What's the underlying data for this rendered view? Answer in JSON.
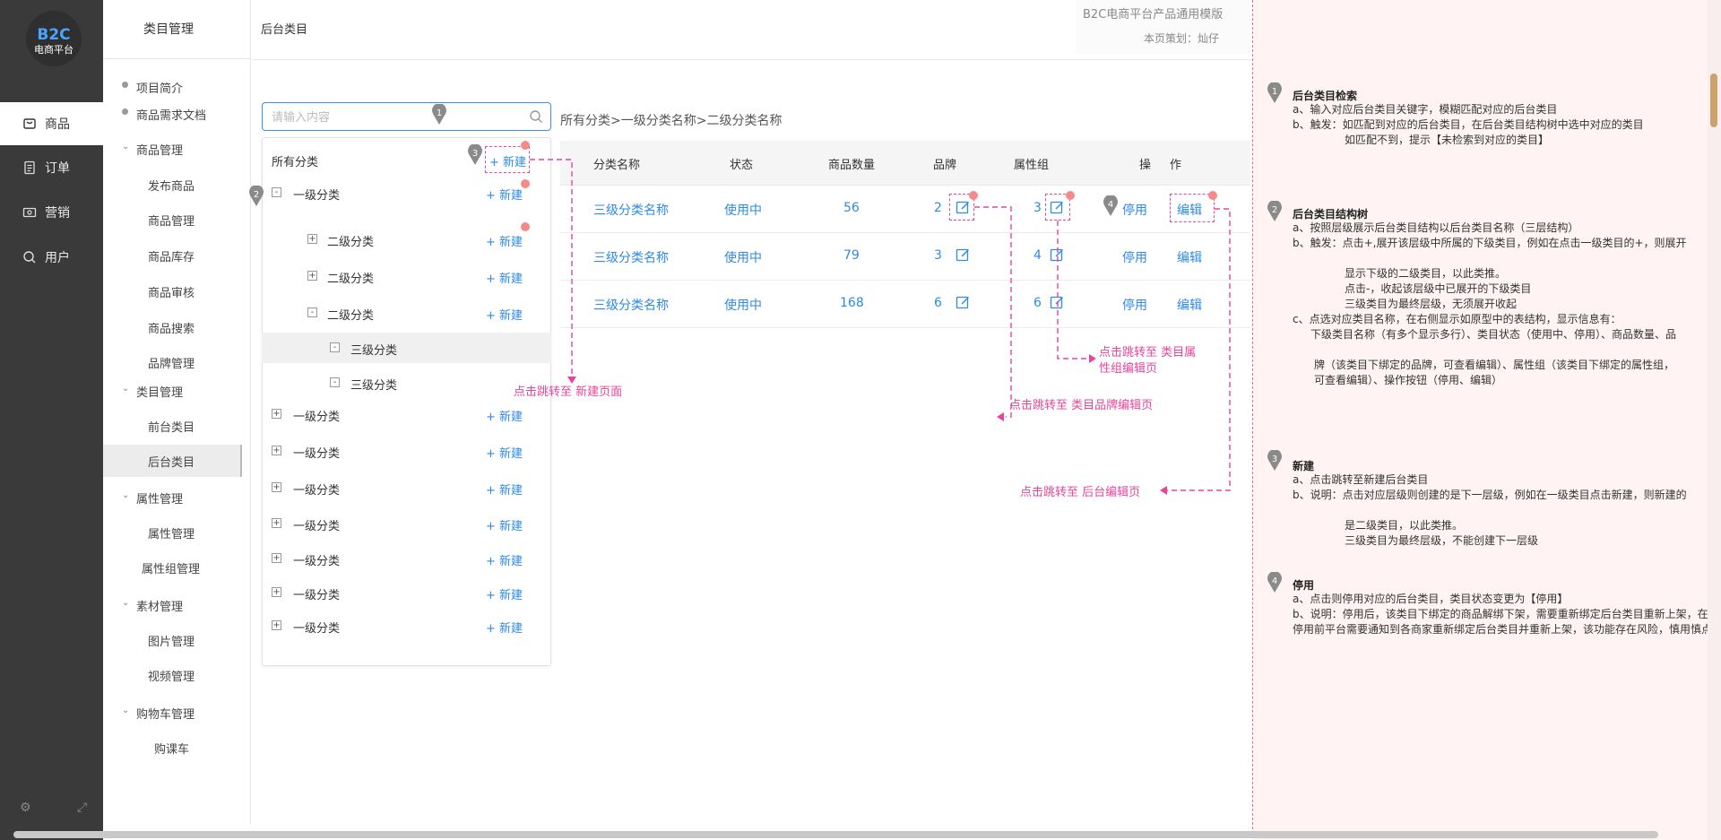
{
  "rail": {
    "logo_line1": "B2C",
    "logo_line2": "电商平台",
    "items": [
      {
        "label": "商品",
        "icon": "cart-icon"
      },
      {
        "label": "订单",
        "icon": "order-icon"
      },
      {
        "label": "营销",
        "icon": "marketing-icon"
      },
      {
        "label": "用户",
        "icon": "user-icon"
      }
    ],
    "footer_icons": [
      "settings-icon",
      "fullscreen-icon"
    ]
  },
  "subnav": {
    "title": "类目管理",
    "top_items": [
      "项目简介",
      "商品需求文档"
    ],
    "groups": [
      {
        "label": "商品管理",
        "items": [
          "发布商品",
          "商品管理",
          "商品库存",
          "商品审核",
          "商品搜索",
          "品牌管理"
        ]
      },
      {
        "label": "类目管理",
        "items": [
          "前台类目",
          "后台类目"
        ]
      },
      {
        "label": "属性管理",
        "items": [
          "属性管理",
          "属性组管理"
        ]
      },
      {
        "label": "素材管理",
        "items": [
          "图片管理",
          "视频管理"
        ]
      },
      {
        "label": "购物车管理",
        "items": [
          "购课车"
        ]
      }
    ],
    "active_item": "后台类目"
  },
  "header": {
    "page_title": "后台类目",
    "proto_title": "B2C电商平台产品通用模版",
    "proto_planner": "本页策划：灿仔"
  },
  "search": {
    "placeholder": "请输入内容",
    "value": ""
  },
  "tree": {
    "root_label": "所有分类",
    "new_label": "+ 新建",
    "root_new_label": "新建",
    "rows": [
      {
        "level": 1,
        "toggle": "-",
        "label": "一级分类"
      },
      {
        "level": 2,
        "toggle": "+",
        "label": "二级分类"
      },
      {
        "level": 2,
        "toggle": "+",
        "label": "二级分类"
      },
      {
        "level": 2,
        "toggle": "-",
        "label": "二级分类"
      },
      {
        "level": 3,
        "toggle": "-",
        "label": "三级分类"
      },
      {
        "level": 3,
        "toggle": "-",
        "label": "三级分类"
      },
      {
        "level": 1,
        "toggle": "+",
        "label": "一级分类"
      },
      {
        "level": 1,
        "toggle": "+",
        "label": "一级分类"
      },
      {
        "level": 1,
        "toggle": "+",
        "label": "一级分类"
      },
      {
        "level": 1,
        "toggle": "+",
        "label": "一级分类"
      },
      {
        "level": 1,
        "toggle": "+",
        "label": "一级分类"
      },
      {
        "level": 1,
        "toggle": "+",
        "label": "一级分类"
      },
      {
        "level": 1,
        "toggle": "+",
        "label": "一级分类"
      }
    ]
  },
  "breadcrumb": "所有分类>一级分类名称>二级分类名称",
  "table": {
    "headers": {
      "name": "分类名称",
      "status": "状态",
      "count": "商品数量",
      "brand": "品牌",
      "attr": "属性组",
      "op1": "操",
      "op2": "作"
    },
    "disable_label": "停用",
    "edit_label": "编辑",
    "rows": [
      {
        "name": "三级分类名称",
        "status": "使用中",
        "count": "56",
        "brand": "2",
        "attr": "3"
      },
      {
        "name": "三级分类名称",
        "status": "使用中",
        "count": "79",
        "brand": "3",
        "attr": "4"
      },
      {
        "name": "三级分类名称",
        "status": "使用中",
        "count": "168",
        "brand": "6",
        "attr": "6"
      }
    ]
  },
  "annotations": {
    "pins": [
      "1",
      "2",
      "3",
      "4"
    ],
    "to_new_page": "点击跳转至 新建页面",
    "to_attr_page_1": "点击跳转至 类目属",
    "to_attr_page_2": "性组编辑页",
    "to_brand_page": "点击跳转至 类目品牌编辑页",
    "to_edit_page": "点击跳转至 后台编辑页"
  },
  "notes": [
    {
      "num": "1",
      "title": "后台类目检索",
      "lines": [
        "a、输入对应后台类目关键字，模糊匹配对应的后台类目",
        "b、触发：如匹配到对应的后台类目，在后台类目结构树中选中对应的类目",
        "如匹配不到，提示【未检索到对应的类目】"
      ]
    },
    {
      "num": "2",
      "title": "后台类目结构树",
      "lines": [
        "a、按照层级展示后台类目结构以后台类目名称（三层结构）",
        "b、触发：点击+,展开该层级中所属的下级类目，例如在点击一级类目的+，则展开",
        "显示下级的二级类目，以此类推。",
        "点击-，收起该层级中已展开的下级类目",
        "三级类目为最终层级，无须展开收起",
        "c、点选对应类目名称，在右侧显示如原型中的表结构，显示信息有：",
        "下级类目名称（有多个显示多行）、类目状态（使用中、停用）、商品数量、品",
        "牌（该类目下绑定的品牌，可查看编辑）、属性组（该类目下绑定的属性组，",
        "可查看编辑）、操作按钮（停用、编辑）"
      ]
    },
    {
      "num": "3",
      "title": "新建",
      "lines": [
        "a、点击跳转至新建后台类目",
        "b、说明：点击对应层级则创建的是下一层级，例如在一级类目点击新建，则新建的",
        "是二级类目，以此类推。",
        "三级类目为最终层级，不能创建下一层级"
      ]
    },
    {
      "num": "4",
      "title": "停用",
      "lines": [
        "a、点击则停用对应的后台类目，类目状态变更为【停用】",
        "b、说明：停用后，该类目下绑定的商品解绑下架，需要重新绑定后台类目重新上架，在停用前平台需要通知到各商家重新绑定后台类目并重新上架，该功能存在风险，慎用慎点"
      ]
    }
  ],
  "colors": {
    "accent": "#2e8ae6",
    "annotation": "#e8459a",
    "rail": "#3a3a3a",
    "notes_bg": "#fff3f3"
  }
}
